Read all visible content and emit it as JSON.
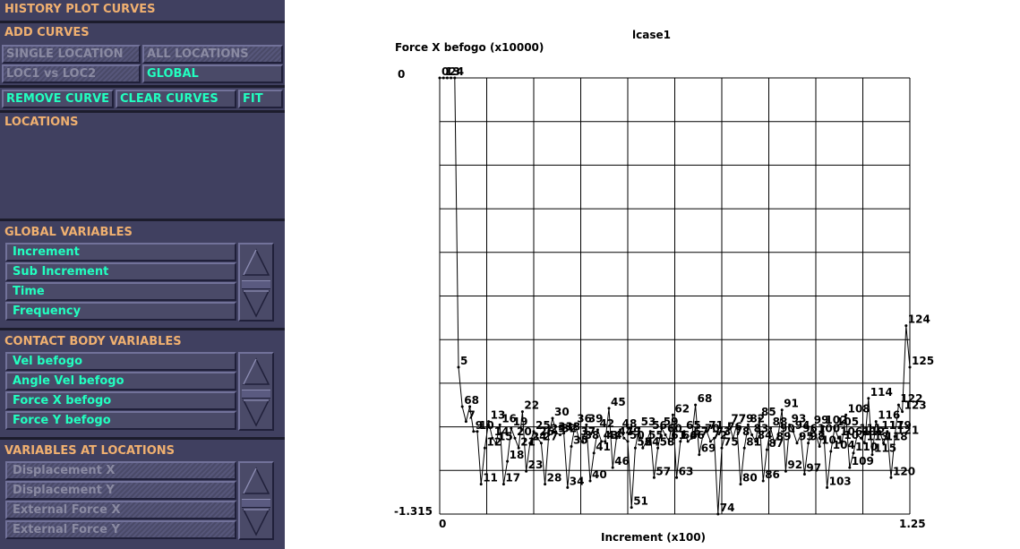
{
  "panel": {
    "title": "HISTORY PLOT CURVES",
    "add_curves": {
      "header": "ADD CURVES",
      "single_location": "SINGLE LOCATION",
      "all_locations": "ALL LOCATIONS",
      "loc1_vs_loc2": "LOC1 vs LOC2",
      "global": "GLOBAL"
    },
    "remove_curve": "REMOVE CURVE",
    "clear_curves": "CLEAR CURVES",
    "fit": "FIT",
    "locations_header": "LOCATIONS",
    "global_variables": {
      "header": "GLOBAL VARIABLES",
      "items": [
        "Increment",
        "Sub Increment",
        "Time",
        "Frequency"
      ]
    },
    "contact_body_variables": {
      "header": "CONTACT BODY VARIABLES",
      "items": [
        "Vel befogo",
        "Angle Vel befogo",
        "Force X befogo",
        "Force Y befogo"
      ]
    },
    "variables_at_locations": {
      "header": "VARIABLES AT LOCATIONS",
      "items": [
        "Displacement X",
        "Displacement Y",
        "External Force X",
        "External Force Y"
      ]
    }
  },
  "chart_data": {
    "type": "line",
    "title": "lcase1",
    "ylabel": "Force X befogo (x10000)",
    "xlabel": "Increment (x100)",
    "xlim": [
      0,
      1.25
    ],
    "ylim": [
      -1.315,
      0
    ],
    "x_tick_labels": [
      "0",
      "1.25"
    ],
    "y_tick_labels": [
      "0",
      "-1.315"
    ],
    "grid": true,
    "points": [
      {
        "x": 0,
        "y": 0,
        "label": "0"
      },
      {
        "x": 0.01,
        "y": 0,
        "label": "1"
      },
      {
        "x": 0.02,
        "y": 0,
        "label": "2"
      },
      {
        "x": 0.03,
        "y": 0,
        "label": "3"
      },
      {
        "x": 0.04,
        "y": 0,
        "label": "4"
      },
      {
        "x": 0.05,
        "y": -0.872,
        "label": "5"
      },
      {
        "x": 0.06,
        "y": -0.991,
        "label": "6"
      },
      {
        "x": 0.07,
        "y": -1.036,
        "label": "7"
      },
      {
        "x": 0.08,
        "y": -0.991,
        "label": "8"
      },
      {
        "x": 0.09,
        "y": -1.066,
        "label": "9"
      },
      {
        "x": 0.1,
        "y": -1.066,
        "label": "10"
      },
      {
        "x": 0.11,
        "y": -1.225,
        "label": "11"
      },
      {
        "x": 0.12,
        "y": -1.116,
        "label": "12"
      },
      {
        "x": 0.13,
        "y": -1.036,
        "label": "13"
      },
      {
        "x": 0.14,
        "y": -1.086,
        "label": "14"
      },
      {
        "x": 0.15,
        "y": -1.101,
        "label": "15"
      },
      {
        "x": 0.16,
        "y": -1.046,
        "label": "16"
      },
      {
        "x": 0.17,
        "y": -1.225,
        "label": "17"
      },
      {
        "x": 0.18,
        "y": -1.156,
        "label": "18"
      },
      {
        "x": 0.19,
        "y": -1.056,
        "label": "19"
      },
      {
        "x": 0.2,
        "y": -1.086,
        "label": "20"
      },
      {
        "x": 0.21,
        "y": -1.116,
        "label": "21"
      },
      {
        "x": 0.22,
        "y": -1.006,
        "label": "22"
      },
      {
        "x": 0.23,
        "y": -1.186,
        "label": "23"
      },
      {
        "x": 0.24,
        "y": -1.101,
        "label": "24"
      },
      {
        "x": 0.25,
        "y": -1.066,
        "label": "25"
      },
      {
        "x": 0.26,
        "y": -1.086,
        "label": "26"
      },
      {
        "x": 0.27,
        "y": -1.101,
        "label": "27"
      },
      {
        "x": 0.28,
        "y": -1.225,
        "label": "28"
      },
      {
        "x": 0.29,
        "y": -1.076,
        "label": "29"
      },
      {
        "x": 0.3,
        "y": -1.026,
        "label": "30"
      },
      {
        "x": 0.31,
        "y": -1.071,
        "label": "31"
      },
      {
        "x": 0.32,
        "y": -1.076,
        "label": "32"
      },
      {
        "x": 0.33,
        "y": -1.071,
        "label": "33"
      },
      {
        "x": 0.34,
        "y": -1.235,
        "label": "34"
      },
      {
        "x": 0.35,
        "y": -1.111,
        "label": "35"
      },
      {
        "x": 0.36,
        "y": -1.046,
        "label": "36"
      },
      {
        "x": 0.37,
        "y": -1.086,
        "label": "37"
      },
      {
        "x": 0.38,
        "y": -1.096,
        "label": "38"
      },
      {
        "x": 0.39,
        "y": -1.046,
        "label": "39"
      },
      {
        "x": 0.4,
        "y": -1.215,
        "label": "40"
      },
      {
        "x": 0.41,
        "y": -1.131,
        "label": "41"
      },
      {
        "x": 0.42,
        "y": -1.061,
        "label": "42"
      },
      {
        "x": 0.43,
        "y": -1.096,
        "label": "43"
      },
      {
        "x": 0.44,
        "y": -1.096,
        "label": "44"
      },
      {
        "x": 0.45,
        "y": -0.996,
        "label": "45"
      },
      {
        "x": 0.46,
        "y": -1.175,
        "label": "46"
      },
      {
        "x": 0.47,
        "y": -1.086,
        "label": "47"
      },
      {
        "x": 0.48,
        "y": -1.061,
        "label": "48"
      },
      {
        "x": 0.49,
        "y": -1.086,
        "label": "49"
      },
      {
        "x": 0.5,
        "y": -1.096,
        "label": "50"
      },
      {
        "x": 0.51,
        "y": -1.295,
        "label": "51"
      },
      {
        "x": 0.52,
        "y": -1.116,
        "label": "52"
      },
      {
        "x": 0.53,
        "y": -1.056,
        "label": "53"
      },
      {
        "x": 0.54,
        "y": -1.116,
        "label": "54"
      },
      {
        "x": 0.55,
        "y": -1.096,
        "label": "55"
      },
      {
        "x": 0.56,
        "y": -1.066,
        "label": "56"
      },
      {
        "x": 0.57,
        "y": -1.205,
        "label": "57"
      },
      {
        "x": 0.58,
        "y": -1.116,
        "label": "58"
      },
      {
        "x": 0.59,
        "y": -1.056,
        "label": "59"
      },
      {
        "x": 0.6,
        "y": -1.076,
        "label": "60"
      },
      {
        "x": 0.61,
        "y": -1.096,
        "label": "61"
      },
      {
        "x": 0.62,
        "y": -1.016,
        "label": "62"
      },
      {
        "x": 0.63,
        "y": -1.205,
        "label": "63"
      },
      {
        "x": 0.64,
        "y": -1.096,
        "label": "64"
      },
      {
        "x": 0.65,
        "y": -1.066,
        "label": "65"
      },
      {
        "x": 0.66,
        "y": -1.096,
        "label": "66"
      },
      {
        "x": 0.67,
        "y": -1.086,
        "label": "67"
      },
      {
        "x": 0.68,
        "y": -0.986,
        "label": "68"
      },
      {
        "x": 0.69,
        "y": -1.136,
        "label": "69"
      },
      {
        "x": 0.7,
        "y": -1.076,
        "label": "70"
      },
      {
        "x": 0.71,
        "y": -1.066,
        "label": "71"
      },
      {
        "x": 0.72,
        "y": -1.096,
        "label": "72"
      },
      {
        "x": 0.73,
        "y": -1.086,
        "label": "73"
      },
      {
        "x": 0.74,
        "y": -1.315,
        "label": "74"
      },
      {
        "x": 0.75,
        "y": -1.116,
        "label": "75"
      },
      {
        "x": 0.76,
        "y": -1.071,
        "label": "76"
      },
      {
        "x": 0.77,
        "y": -1.046,
        "label": "77"
      },
      {
        "x": 0.78,
        "y": -1.086,
        "label": "78"
      },
      {
        "x": 0.79,
        "y": -1.046,
        "label": "79"
      },
      {
        "x": 0.8,
        "y": -1.225,
        "label": "80"
      },
      {
        "x": 0.81,
        "y": -1.116,
        "label": "81"
      },
      {
        "x": 0.82,
        "y": -1.046,
        "label": "82"
      },
      {
        "x": 0.83,
        "y": -1.076,
        "label": "83"
      },
      {
        "x": 0.84,
        "y": -1.096,
        "label": "84"
      },
      {
        "x": 0.85,
        "y": -1.026,
        "label": "85"
      },
      {
        "x": 0.86,
        "y": -1.215,
        "label": "86"
      },
      {
        "x": 0.87,
        "y": -1.121,
        "label": "87"
      },
      {
        "x": 0.88,
        "y": -1.056,
        "label": "88"
      },
      {
        "x": 0.89,
        "y": -1.101,
        "label": "89"
      },
      {
        "x": 0.9,
        "y": -1.076,
        "label": "90"
      },
      {
        "x": 0.91,
        "y": -1.001,
        "label": "91"
      },
      {
        "x": 0.92,
        "y": -1.186,
        "label": "92"
      },
      {
        "x": 0.93,
        "y": -1.046,
        "label": "93"
      },
      {
        "x": 0.94,
        "y": -1.066,
        "label": "94"
      },
      {
        "x": 0.95,
        "y": -1.101,
        "label": "95"
      },
      {
        "x": 0.96,
        "y": -1.076,
        "label": "96"
      },
      {
        "x": 0.97,
        "y": -1.195,
        "label": "97"
      },
      {
        "x": 0.98,
        "y": -1.101,
        "label": "98"
      },
      {
        "x": 0.99,
        "y": -1.051,
        "label": "99"
      },
      {
        "x": 1.0,
        "y": -1.076,
        "label": "100"
      },
      {
        "x": 1.01,
        "y": -1.111,
        "label": "101"
      },
      {
        "x": 1.02,
        "y": -1.051,
        "label": "102"
      },
      {
        "x": 1.03,
        "y": -1.235,
        "label": "103"
      },
      {
        "x": 1.04,
        "y": -1.126,
        "label": "104"
      },
      {
        "x": 1.05,
        "y": -1.056,
        "label": "105"
      },
      {
        "x": 1.06,
        "y": -1.086,
        "label": "106"
      },
      {
        "x": 1.07,
        "y": -1.096,
        "label": "107"
      },
      {
        "x": 1.08,
        "y": -1.016,
        "label": "108"
      },
      {
        "x": 1.09,
        "y": -1.175,
        "label": "109"
      },
      {
        "x": 1.1,
        "y": -1.131,
        "label": "110"
      },
      {
        "x": 1.11,
        "y": -1.076,
        "label": "111"
      },
      {
        "x": 1.12,
        "y": -1.086,
        "label": "112"
      },
      {
        "x": 1.13,
        "y": -1.101,
        "label": "113"
      },
      {
        "x": 1.14,
        "y": -0.966,
        "label": "114"
      },
      {
        "x": 1.15,
        "y": -1.136,
        "label": "115"
      },
      {
        "x": 1.16,
        "y": -1.036,
        "label": "116"
      },
      {
        "x": 1.17,
        "y": -1.066,
        "label": "117"
      },
      {
        "x": 1.18,
        "y": -1.101,
        "label": "118"
      },
      {
        "x": 1.19,
        "y": -1.066,
        "label": "119"
      },
      {
        "x": 1.2,
        "y": -1.205,
        "label": "120"
      },
      {
        "x": 1.21,
        "y": -1.081,
        "label": "121"
      },
      {
        "x": 1.22,
        "y": -0.986,
        "label": "122"
      },
      {
        "x": 1.23,
        "y": -1.006,
        "label": "123"
      },
      {
        "x": 1.24,
        "y": -0.747,
        "label": "124"
      },
      {
        "x": 1.25,
        "y": -0.872,
        "label": "125"
      }
    ]
  }
}
